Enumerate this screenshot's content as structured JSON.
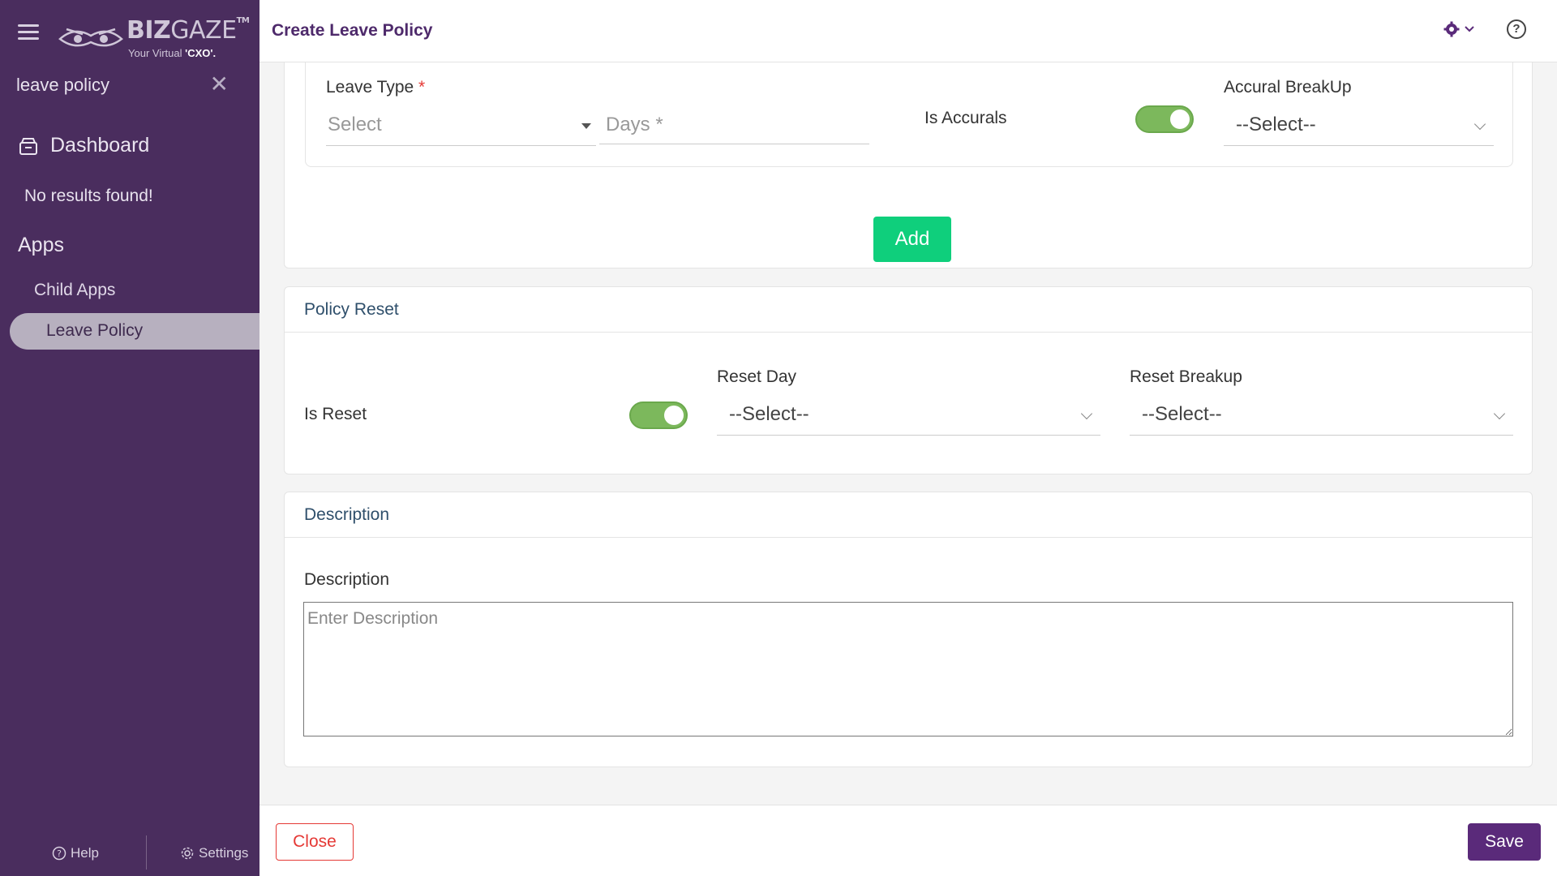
{
  "brand": {
    "name_bold": "BIZ",
    "name_light": "GAZE",
    "trademark": "TM",
    "tagline": "Your Virtual",
    "tagline_em": "'CXO'."
  },
  "sidebar": {
    "search_value": "leave policy",
    "dashboard_label": "Dashboard",
    "no_results": "No results found!",
    "apps_heading": "Apps",
    "child_apps": "Child Apps",
    "active_item": "Leave Policy",
    "help_label": "Help",
    "settings_label": "Settings"
  },
  "header": {
    "title": "Create Leave Policy"
  },
  "leave_type_row": {
    "leave_type_label": "Leave Type",
    "required_mark": "*",
    "leave_type_value": "Select",
    "days_placeholder": "Days *",
    "is_accurals_label": "Is Accurals",
    "is_accurals_on": true,
    "accural_breakup_label": "Accural BreakUp",
    "accural_breakup_value": "--Select--",
    "add_label": "Add"
  },
  "policy_reset": {
    "heading": "Policy Reset",
    "is_reset_label": "Is Reset",
    "is_reset_on": true,
    "reset_day_label": "Reset Day",
    "reset_day_value": "--Select--",
    "reset_breakup_label": "Reset Breakup",
    "reset_breakup_value": "--Select--"
  },
  "description": {
    "heading": "Description",
    "field_label": "Description",
    "placeholder": "Enter Description"
  },
  "footer": {
    "close_label": "Close",
    "save_label": "Save"
  },
  "colors": {
    "sidebar_bg": "#4a2d5e",
    "title_color": "#4e2a6b",
    "toggle_on": "#7cb85c",
    "add_button": "#0fcf7c",
    "save_button": "#5a2a7a",
    "close_border": "#e53935"
  }
}
